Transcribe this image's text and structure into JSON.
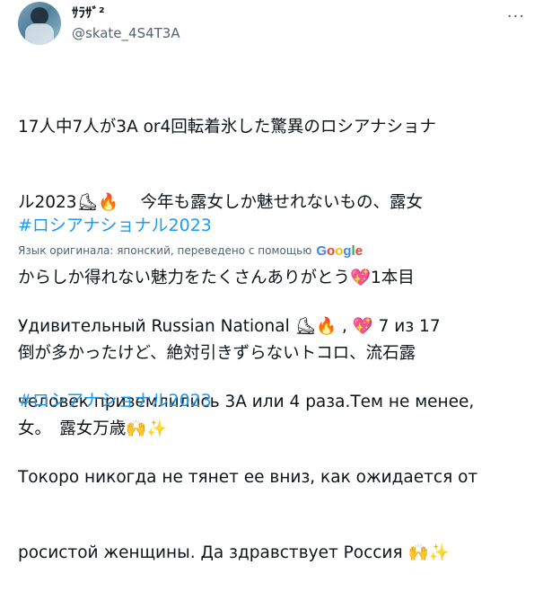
{
  "author": {
    "display_name": "ｻﾗｻﾞ²",
    "handle": "@skate_4S4T3A"
  },
  "tweet": {
    "original_lines": [
      "17人中7人が3A or4回転着氷した驚異のロシアナショナ",
      "ル2023⛸🔥　 今年も露女しか魅せれないもの、露女",
      "からしか得れない魅力をたくさんありがとう💖1本目",
      "倒が多かったけど、絶対引きずらないトコロ、流石露",
      "女。　露女万歳🙌✨"
    ],
    "hashtag": "#ロシアナショナル2023",
    "translation_label": "Язык оригинала: японский, переведено с помощью",
    "translation_provider": "Google",
    "translated_lines": [
      "Удивительный Russian National ⛸🔥 , 💖 7 из 17",
      "человек приземлились 3А или 4 раза.Тем не менее,",
      "Токоро никогда не тянет ее вниз, как ожидается от",
      "росистой женщины. Да здравствует Россия 🙌✨"
    ],
    "hashtag_translated": "#ロシアナショナル2023"
  },
  "icons": {
    "more": "more-icon",
    "google_colors": [
      "#4285f4",
      "#ea4335",
      "#fbbc05",
      "#4285f4",
      "#34a853",
      "#ea4335"
    ]
  },
  "colors": {
    "link": "#1d9bf0",
    "secondary_text": "#536471",
    "primary_text": "#0f1419"
  }
}
